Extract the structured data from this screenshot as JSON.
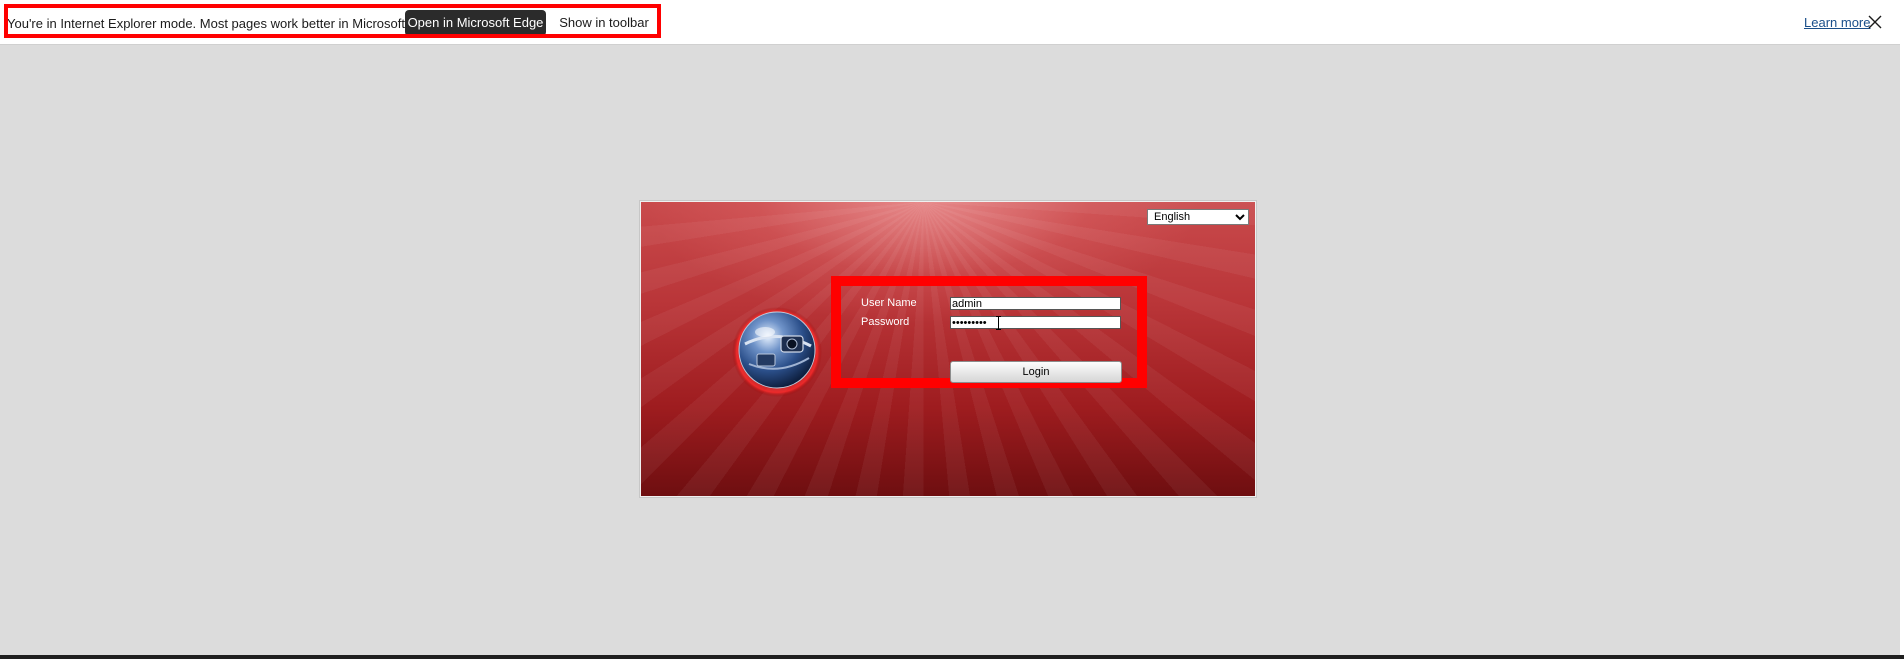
{
  "infobar": {
    "message": "You're in Internet Explorer mode. Most pages work better in Microsoft Edge.",
    "open_edge_label": "Open in Microsoft Edge",
    "show_toolbar_label": "Show in toolbar",
    "learn_more_label": "Learn more",
    "close_icon": "close-icon"
  },
  "login": {
    "language": {
      "selected": "English",
      "options": [
        "English"
      ]
    },
    "username_label": "User Name",
    "username_value": "admin",
    "password_label": "Password",
    "password_value": "•••••••••",
    "login_button_label": "Login",
    "logo_icon": "globe-camera-icon"
  },
  "colors": {
    "panel_top": "#c94a4c",
    "panel_bottom": "#6e0e10",
    "highlight": "#ff0000",
    "page_background": "#dcdcdc",
    "edge_button_bg": "#2b2b2b"
  }
}
